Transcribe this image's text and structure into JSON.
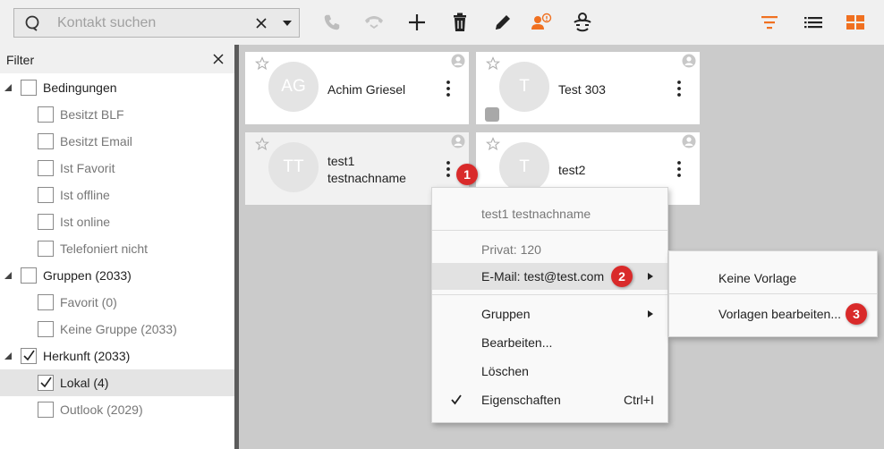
{
  "colors": {
    "accent": "#f07020",
    "badge": "#d92a2a"
  },
  "search": {
    "placeholder": "Kontakt suchen",
    "clear_icon": "close-icon",
    "dropdown_icon": "caret-down-icon"
  },
  "toolbar": {
    "left_icons": [
      "phone-icon",
      "phone-transfer-icon",
      "plus-icon",
      "trash-icon",
      "pencil-icon",
      "contact-info-icon",
      "voicemail-icon"
    ],
    "right_icons": [
      "filter-icon",
      "list-view-icon",
      "grid-view-icon"
    ]
  },
  "filter": {
    "title": "Filter",
    "tree": [
      {
        "label": "Bedingungen",
        "level": 0,
        "checked": false,
        "expandable": true
      },
      {
        "label": "Besitzt BLF",
        "level": 1,
        "checked": false
      },
      {
        "label": "Besitzt Email",
        "level": 1,
        "checked": false
      },
      {
        "label": "Ist Favorit",
        "level": 1,
        "checked": false
      },
      {
        "label": "Ist offline",
        "level": 1,
        "checked": false
      },
      {
        "label": "Ist online",
        "level": 1,
        "checked": false
      },
      {
        "label": "Telefoniert nicht",
        "level": 1,
        "checked": false
      },
      {
        "label": "Gruppen (2033)",
        "level": 0,
        "checked": false,
        "expandable": true
      },
      {
        "label": "Favorit (0)",
        "level": 1,
        "checked": false
      },
      {
        "label": "Keine Gruppe (2033)",
        "level": 1,
        "checked": false
      },
      {
        "label": "Herkunft (2033)",
        "level": 0,
        "checked": true,
        "expandable": true
      },
      {
        "label": "Lokal (4)",
        "level": 1,
        "checked": true,
        "selected": true
      },
      {
        "label": "Outlook (2029)",
        "level": 1,
        "checked": false
      }
    ]
  },
  "contacts": [
    {
      "initials": "AG",
      "name_line1": "Achim Griesel",
      "name_line2": ""
    },
    {
      "initials": "T",
      "name_line1": "Test 303",
      "name_line2": ""
    },
    {
      "initials": "TT",
      "name_line1": "test1",
      "name_line2": "testnachname"
    },
    {
      "initials": "T",
      "name_line1": "test2",
      "name_line2": ""
    }
  ],
  "context_menu": {
    "header": "test1 testnachname",
    "phone": "Privat: 120",
    "email": "E-Mail: test@test.com",
    "groups": "Gruppen",
    "edit": "Bearbeiten...",
    "delete": "Löschen",
    "properties": "Eigenschaften",
    "properties_shortcut": "Ctrl+I"
  },
  "submenu": {
    "no_template": "Keine Vorlage",
    "edit_templates": "Vorlagen bearbeiten..."
  },
  "badges": [
    "1",
    "2",
    "3"
  ]
}
